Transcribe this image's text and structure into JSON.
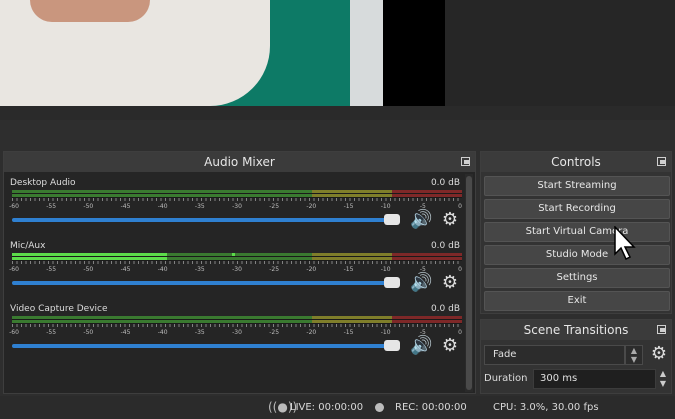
{
  "mixer": {
    "title": "Audio Mixer",
    "channels": [
      {
        "name": "Desktop Audio",
        "db": "0.0 dB"
      },
      {
        "name": "Mic/Aux",
        "db": "0.0 dB"
      },
      {
        "name": "Video Capture Device",
        "db": "0.0 dB"
      }
    ],
    "ticks": [
      "-60",
      "-55",
      "-50",
      "-45",
      "-40",
      "-35",
      "-30",
      "-25",
      "-20",
      "-15",
      "-10",
      "-5",
      "0"
    ]
  },
  "controls": {
    "title": "Controls",
    "buttons": [
      "Start Streaming",
      "Start Recording",
      "Start Virtual Camera",
      "Studio Mode",
      "Settings",
      "Exit"
    ]
  },
  "transitions": {
    "title": "Scene Transitions",
    "selected": "Fade",
    "duration_label": "Duration",
    "duration_value": "300 ms"
  },
  "status": {
    "live": "LIVE: 00:00:00",
    "rec": "REC: 00:00:00",
    "cpu": "CPU: 3.0%, 30.00 fps"
  },
  "colors": {
    "meter_green": "#3c8a2e",
    "meter_yellow": "#8a8a2c",
    "meter_red": "#8a2c2c",
    "meter_active": "#5cdc4a",
    "fader": "#2f80d1"
  }
}
